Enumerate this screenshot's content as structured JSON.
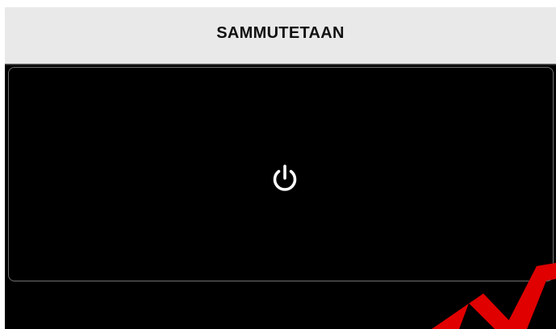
{
  "header": {
    "title": "SAMMUTETAAN"
  },
  "panel": {
    "icon": "power-icon"
  },
  "colors": {
    "header_bg": "#e9e9e9",
    "screen_bg": "#000000",
    "panel_border": "#6f6f6f",
    "icon": "#ffffff",
    "watermark": "#e00000"
  }
}
